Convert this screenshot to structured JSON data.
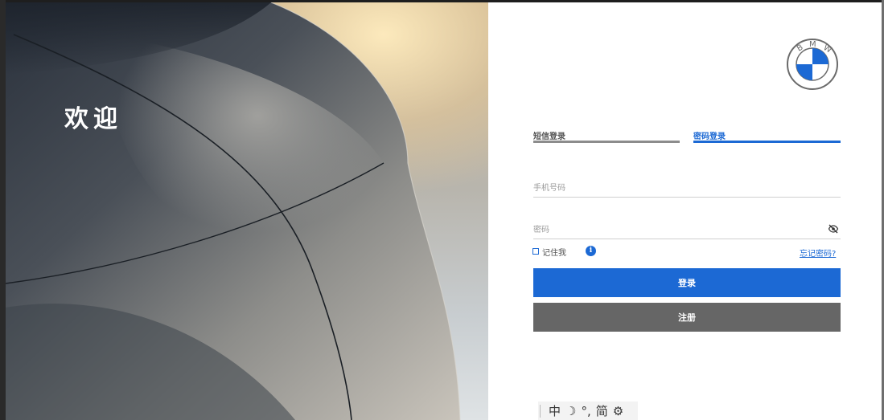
{
  "hero": {
    "title": "欢迎"
  },
  "tabs": [
    {
      "label": "短信登录",
      "active": false
    },
    {
      "label": "密码登录",
      "active": true
    }
  ],
  "form": {
    "phone_placeholder": "手机号码",
    "password_placeholder": "密码",
    "remember_label": "记住我",
    "forgot_link": "忘记密码?",
    "login_button": "登录",
    "register_button": "注册"
  },
  "ime_bar": {
    "mode": "中",
    "moon": "☽",
    "punct": "°,",
    "script": "简",
    "settings": "⚙"
  },
  "colors": {
    "accent": "#1c69d4",
    "register": "#666666"
  },
  "logo": {
    "letters": [
      "B",
      "M",
      "W"
    ]
  }
}
